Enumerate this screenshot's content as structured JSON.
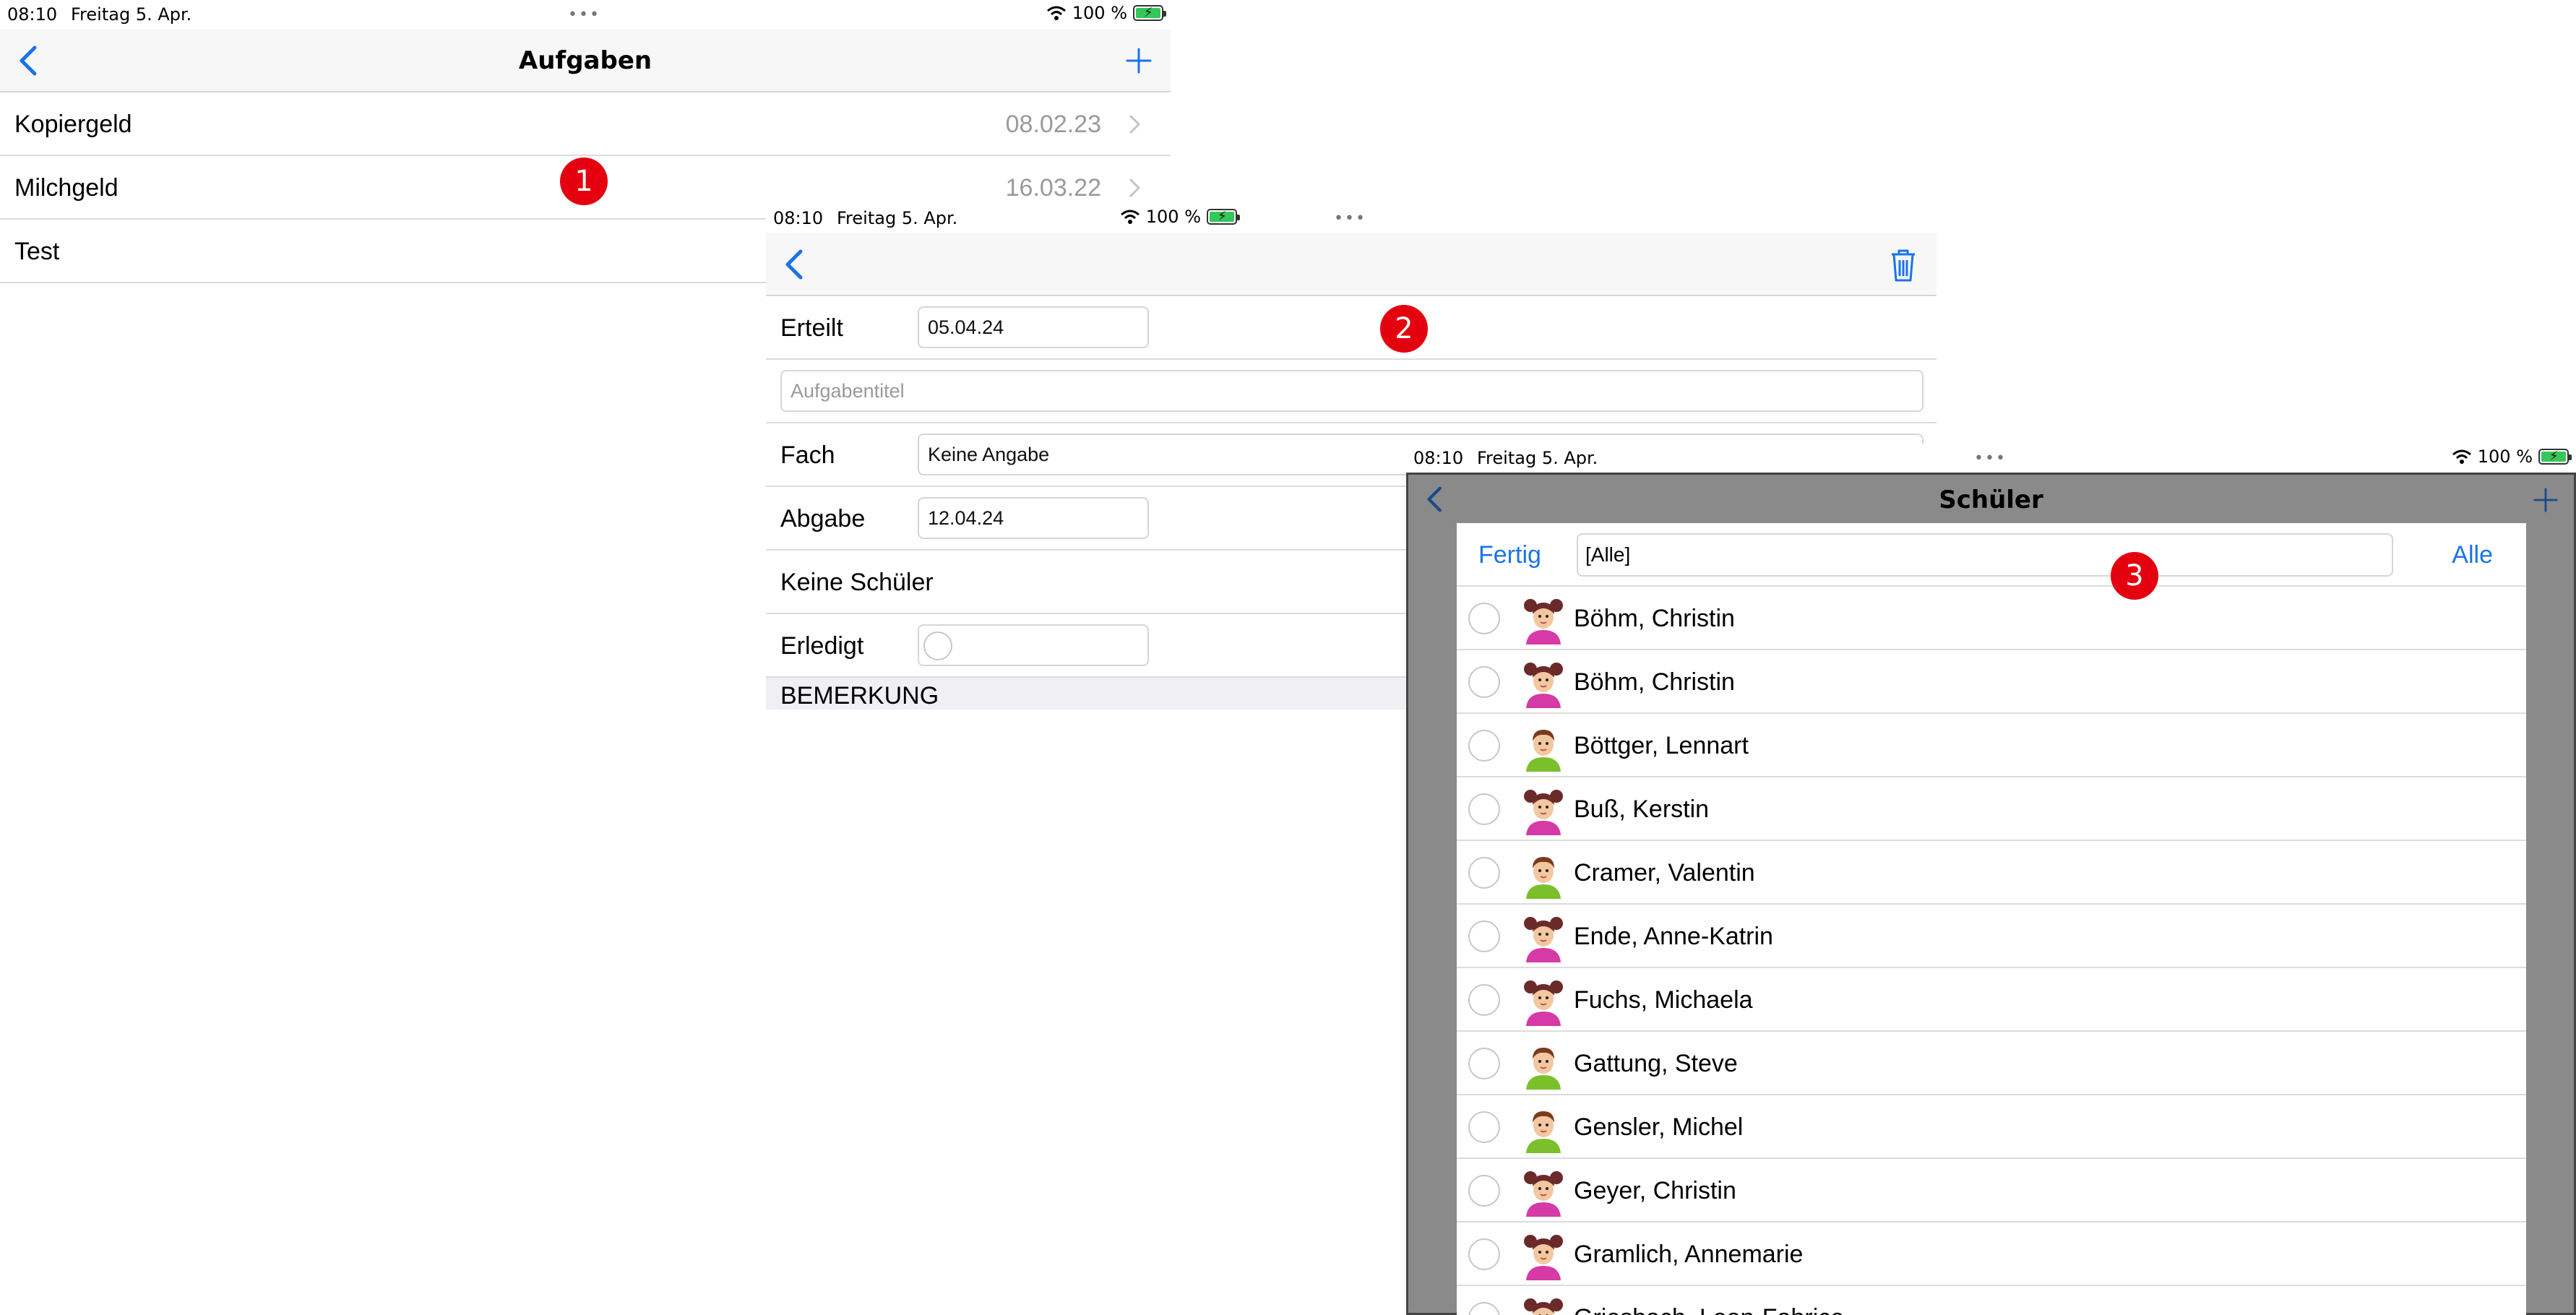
{
  "status": {
    "time": "08:10",
    "date": "Freitag 5. Apr.",
    "battery": "100 %"
  },
  "panel1": {
    "title": "Aufgaben",
    "badge": "1",
    "rows": [
      {
        "label": "Kopiergeld",
        "date": "08.02.23"
      },
      {
        "label": "Milchgeld",
        "date": "16.03.22"
      },
      {
        "label": "Test",
        "date": ""
      }
    ]
  },
  "panel2": {
    "badge": "2",
    "erteilt_label": "Erteilt",
    "erteilt_value": "05.04.24",
    "title_placeholder": "Aufgabentitel",
    "fach_label": "Fach",
    "fach_value": "Keine Angabe",
    "abgabe_label": "Abgabe",
    "abgabe_value": "12.04.24",
    "schueler_label": "Keine Schüler",
    "erledigt_label": "Erledigt",
    "section": "BEMERKUNG"
  },
  "panel3": {
    "title": "Schüler",
    "badge": "3",
    "done": "Fertig",
    "filter": "[Alle]",
    "all": "Alle",
    "students": [
      {
        "name": "Böhm, Christin",
        "gender": "f"
      },
      {
        "name": "Böhm, Christin",
        "gender": "f"
      },
      {
        "name": "Böttger, Lennart",
        "gender": "m"
      },
      {
        "name": "Buß, Kerstin",
        "gender": "f"
      },
      {
        "name": "Cramer, Valentin",
        "gender": "m"
      },
      {
        "name": "Ende, Anne-Katrin",
        "gender": "f"
      },
      {
        "name": "Fuchs, Michaela",
        "gender": "f"
      },
      {
        "name": "Gattung, Steve",
        "gender": "m"
      },
      {
        "name": "Gensler, Michel",
        "gender": "m"
      },
      {
        "name": "Geyer, Christin",
        "gender": "f"
      },
      {
        "name": "Gramlich, Annemarie",
        "gender": "f"
      },
      {
        "name": "Griesbach, Leon-Fabrice",
        "gender": "f"
      }
    ]
  },
  "colors": {
    "accent": "#1a73e8",
    "badge": "#e4000f",
    "battery": "#34c759",
    "overlay": "#8a8a8a"
  },
  "icons": [
    "back-chevron-icon",
    "plus-icon",
    "trash-icon",
    "wifi-icon",
    "battery-icon",
    "chevron-right-icon",
    "avatar-girl-icon",
    "avatar-boy-icon"
  ]
}
